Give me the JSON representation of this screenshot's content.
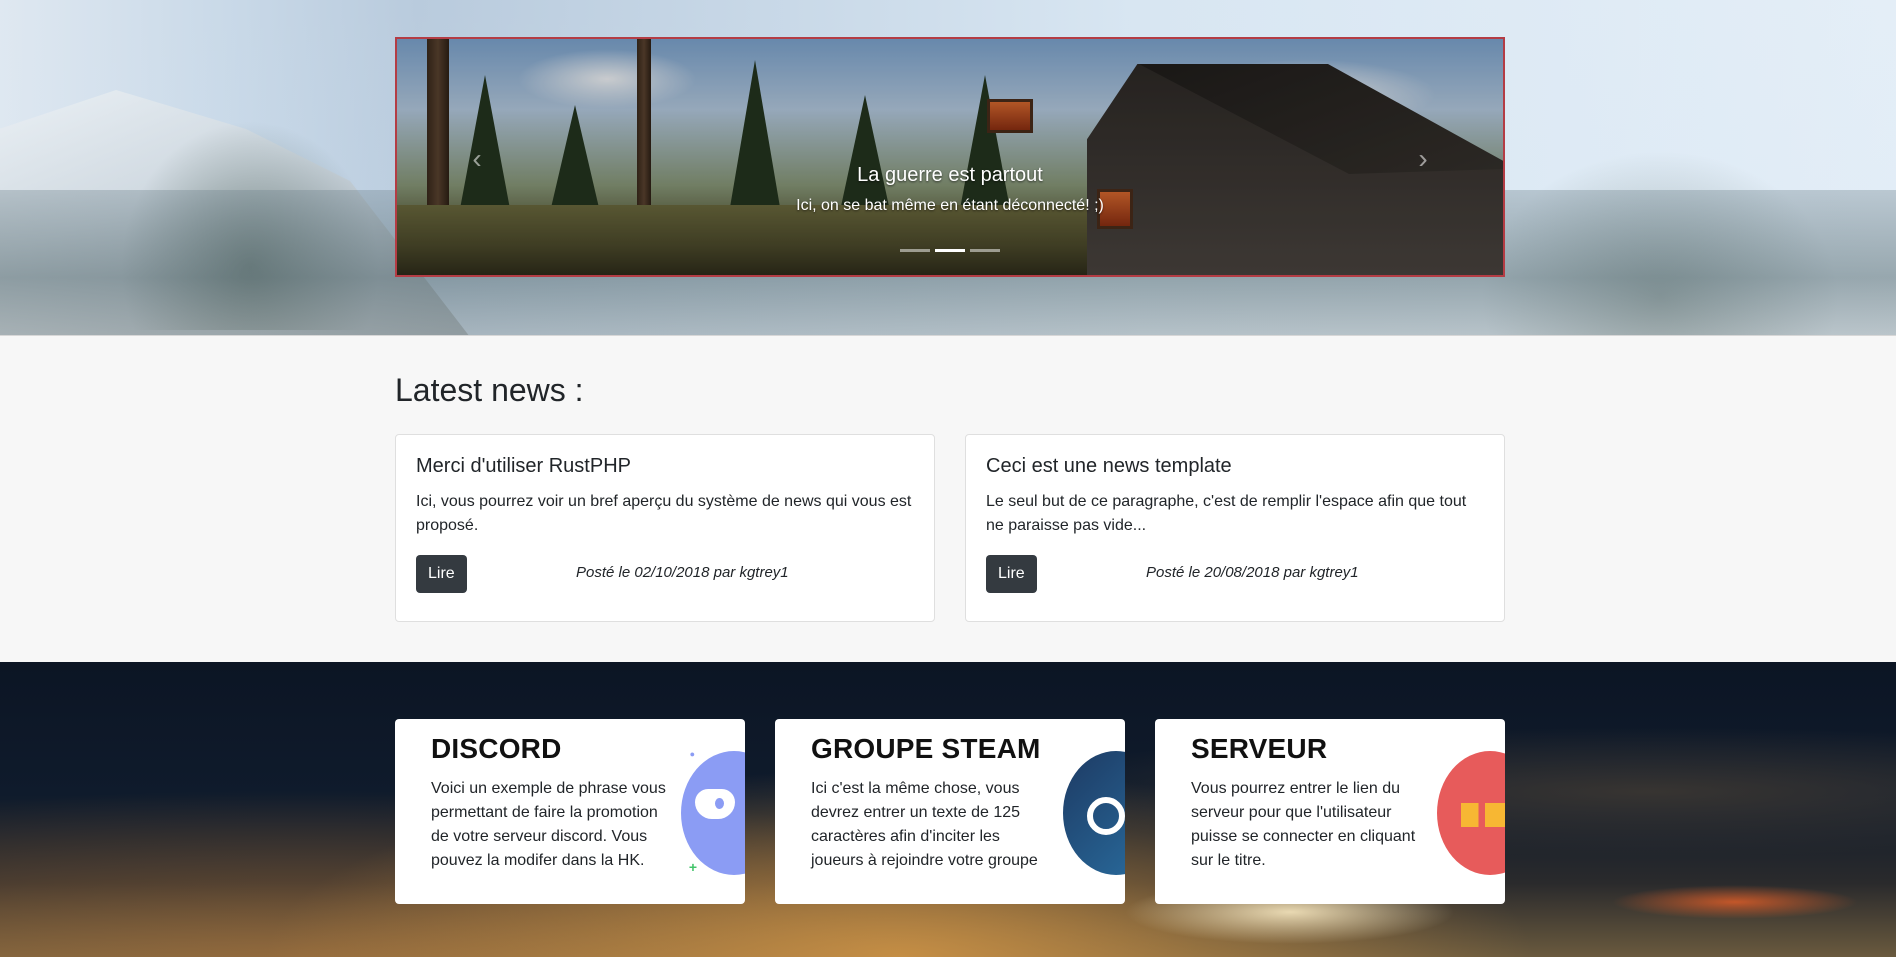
{
  "carousel": {
    "slide_title": "La guerre est partout",
    "slide_text": "Ici, on se bat même en étant déconnecté! ;)",
    "prev_label": "‹",
    "next_label": "›",
    "slide_count": 3,
    "active_slide": 2
  },
  "news": {
    "heading": "Latest news :",
    "items": [
      {
        "title": "Merci d'utiliser RustPHP",
        "text": "Ici, vous pourrez voir un bref aperçu du système de news qui vous est proposé.",
        "button": "Lire",
        "meta": "Posté le 02/10/2018 par kgtrey1"
      },
      {
        "title": "Ceci est une news template",
        "text": "Le seul but de ce paragraphe, c'est de remplir l'espace afin que tout ne paraisse pas vide...",
        "button": "Lire",
        "meta": "Posté le 20/08/2018 par kgtrey1"
      }
    ]
  },
  "community": {
    "cards": [
      {
        "title": "DISCORD",
        "text": "Voici un exemple de phrase vous permettant de faire la promotion de votre serveur discord. Vous pouvez la modifer dans la HK.",
        "icon": "discord-icon",
        "color": "#8b9cf4"
      },
      {
        "title": "GROUPE STEAM",
        "text": "Ici c'est la même chose, vous devrez entrer un texte de 125 caractères afin d'inciter les joueurs à rejoindre votre groupe",
        "icon": "steam-icon",
        "color": "#1d3a63"
      },
      {
        "title": "SERVEUR",
        "text": "Vous pourrez entrer le lien du serveur pour que l'utilisateur puisse se connecter en cliquant sur le titre.",
        "icon": "server-icon",
        "color": "#e75b5b"
      }
    ]
  },
  "colors": {
    "carousel_border": "#b43c44",
    "button_bg": "#343a40",
    "page_bg": "#f7f7f7"
  }
}
